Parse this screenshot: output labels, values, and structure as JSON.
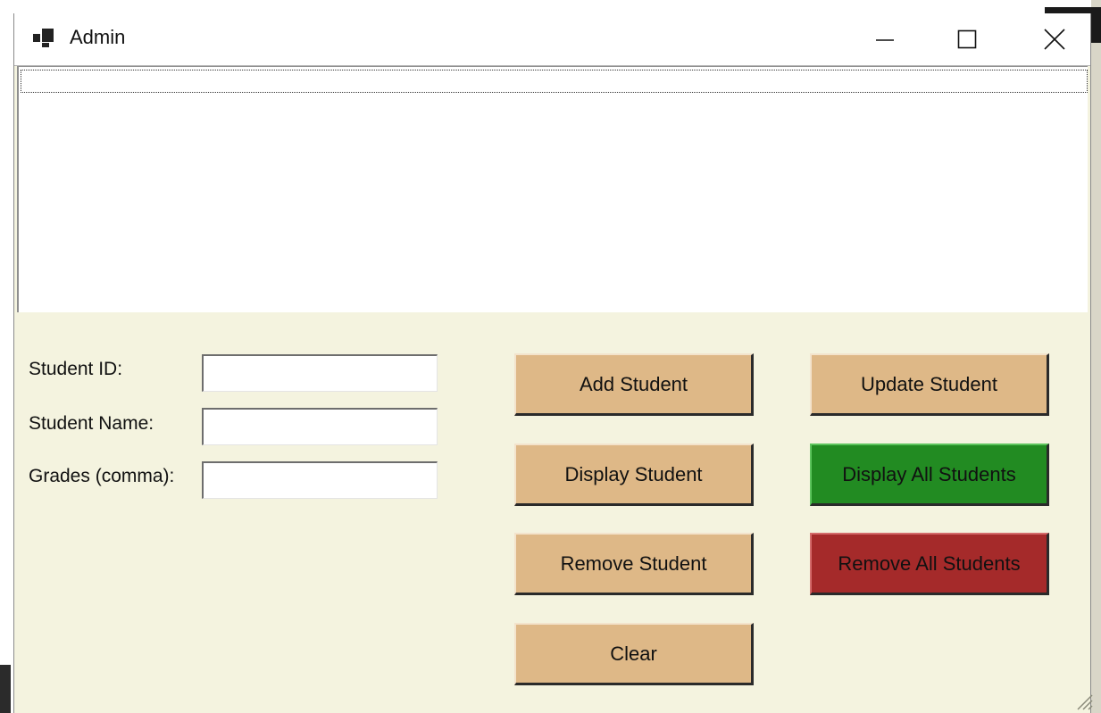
{
  "window": {
    "title": "Admin",
    "controls": {
      "minimize_icon": "minimize-icon",
      "maximize_icon": "maximize-icon",
      "close_icon": "close-icon"
    }
  },
  "listbox": {
    "items": []
  },
  "form": {
    "student_id_label": "Student ID:",
    "student_id_value": "",
    "student_name_label": "Student Name:",
    "student_name_value": "",
    "grades_label": "Grades (comma):",
    "grades_value": ""
  },
  "buttons": {
    "add_student": "Add Student",
    "update_student": "Update Student",
    "display_student": "Display Student",
    "display_all_students": "Display All Students",
    "remove_student": "Remove Student",
    "remove_all_students": "Remove All Students",
    "clear": "Clear"
  },
  "colors": {
    "form_background": "#f4f3df",
    "button_tan": "#deb887",
    "button_green": "#228b22",
    "button_red": "#a52a2a"
  }
}
